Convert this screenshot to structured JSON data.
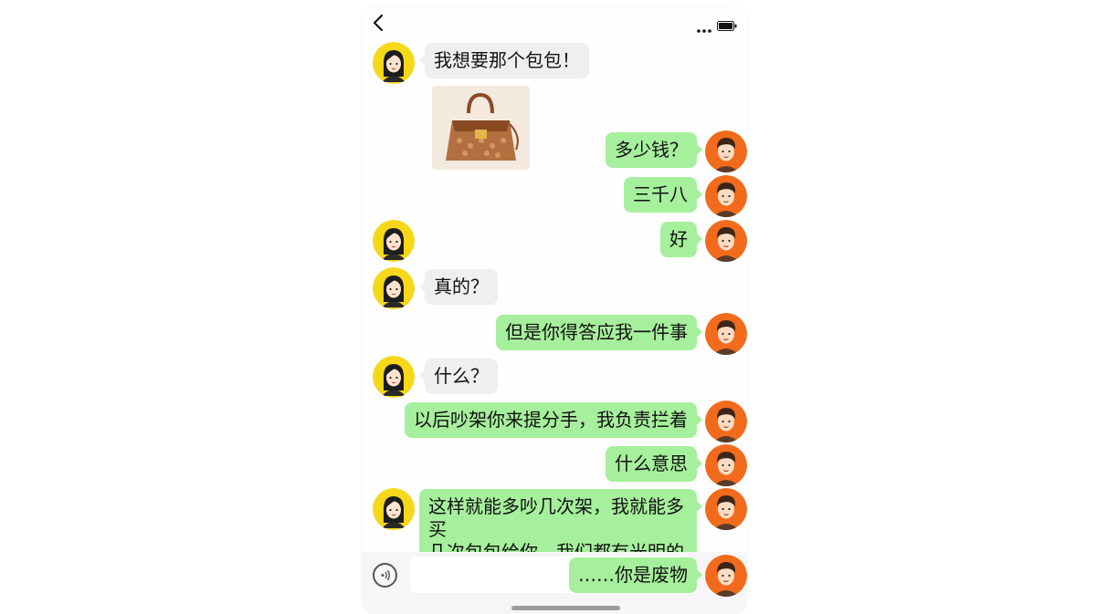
{
  "header": {
    "back_icon": "chevron-left-icon",
    "menu_icon": "more-dots-icon",
    "battery_icon": "battery-icon"
  },
  "participants": {
    "girl": {
      "avatar": "girl-avatar",
      "avatar_bg": "#f6d81b"
    },
    "boy": {
      "avatar": "boy-avatar",
      "avatar_bg": "#f26b1d"
    }
  },
  "colors": {
    "left_bubble": "#efefef",
    "right_bubble": "#a6ef9c"
  },
  "messages": [
    {
      "side": "left",
      "text": "我想要那个包包！"
    },
    {
      "side": "left",
      "type": "image",
      "alt": "handbag-photo"
    },
    {
      "side": "right",
      "text": "多少钱？"
    },
    {
      "side": "right",
      "text": "三千八"
    },
    {
      "side": "right",
      "text": "好"
    },
    {
      "side": "left",
      "text": "真的？"
    },
    {
      "side": "right",
      "text": "但是你得答应我一件事"
    },
    {
      "side": "left",
      "text": "什么？"
    },
    {
      "side": "right",
      "text": "以后吵架你来提分手，我负责拦着"
    },
    {
      "side": "right",
      "text": "什么意思"
    },
    {
      "side": "left",
      "lines": [
        "这样就能多吵几次架，我就能多买",
        "几次包包给你，我们都有光明的未来"
      ]
    },
    {
      "side": "right",
      "text": "……你是废物"
    }
  ],
  "input_bar": {
    "voice_icon": "voice-icon",
    "placeholder": ""
  }
}
